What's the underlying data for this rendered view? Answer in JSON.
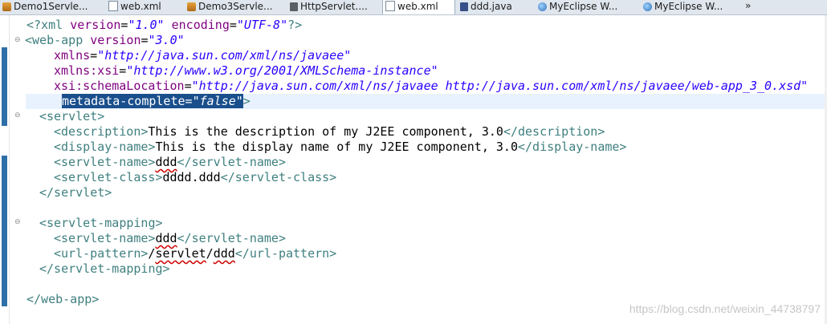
{
  "tabs": [
    {
      "label": "Demo1Servle...",
      "icon": "coffee-icon"
    },
    {
      "label": "web.xml",
      "icon": "xml-file-icon"
    },
    {
      "label": "Demo3Servle...",
      "icon": "coffee-icon"
    },
    {
      "label": "HttpServlet....",
      "icon": "class-file-icon"
    },
    {
      "label": "web.xml",
      "icon": "xml-file-icon",
      "active": true
    },
    {
      "label": "ddd.java",
      "icon": "java-file-icon"
    },
    {
      "label": "MyEclipse W...",
      "icon": "globe-icon"
    },
    {
      "label": "MyEclipse W...",
      "icon": "globe-icon"
    }
  ],
  "tab_overflow": "»",
  "code": {
    "l0": {
      "a": "<?xml ",
      "b": "version",
      "c": "=",
      "d": "\"1.0\"",
      "e": " ",
      "f": "encoding",
      "g": "=",
      "h": "\"UTF-8\"",
      "i": "?>"
    },
    "l1": {
      "a": "<web-app ",
      "b": "version",
      "c": "=",
      "d": "\"3.0\""
    },
    "l2": {
      "a": "xmlns",
      "b": "=",
      "c": "\"http://java.sun.com/xml/ns/javaee\""
    },
    "l3": {
      "a": "xmlns:xsi",
      "b": "=",
      "c": "\"http://www.w3.org/2001/XMLSchema-instance\""
    },
    "l4": {
      "a": "xsi:schemaLocation",
      "b": "=",
      "c": "\"http://java.sun.com/xml/ns/javaee http://java.sun.com/xml/ns/javaee/web-app_3_0.xsd\""
    },
    "l5": {
      "a": "metadata-complete",
      "b": "=",
      "c": "\"false\"",
      "d": ">"
    },
    "l6": {
      "a": "<servlet>"
    },
    "l7": {
      "a": "<description>",
      "b": "This is the description of my J2EE component, 3.0",
      "c": "</description>"
    },
    "l8": {
      "a": "<display-name>",
      "b": "This is the display name of my J2EE component, 3.0",
      "c": "</display-name>"
    },
    "l9": {
      "a": "<servlet-name>",
      "b": "ddd",
      "c": "</servlet-name>"
    },
    "l10": {
      "a": "<servlet-class>",
      "b": "dddd.ddd",
      "c": "</servlet-class>"
    },
    "l11": {
      "a": "</servlet>"
    },
    "l13": {
      "a": "<servlet-mapping>"
    },
    "l14": {
      "a": "<servlet-name>",
      "b": "ddd",
      "c": "</servlet-name>"
    },
    "l15": {
      "a": "<url-pattern>",
      "b": "/",
      "c": "servlet",
      "d": "/",
      "e": "ddd",
      "f": "</url-pattern>"
    },
    "l16": {
      "a": "</servlet-mapping>"
    },
    "l18": {
      "a": "</web-app>"
    }
  },
  "watermark": "https://blog.csdn.net/weixin_44738797",
  "colors": {
    "tag": "#3f7f7f",
    "attribute": "#7f007f",
    "value": "#2a00ff",
    "selection": "#1a4f8c",
    "change_bar": "#2f6fa8"
  }
}
